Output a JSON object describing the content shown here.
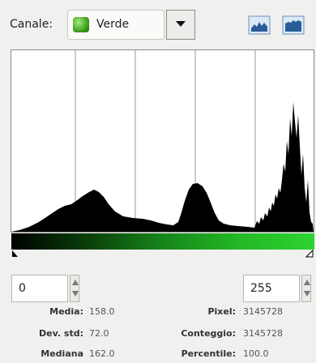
{
  "channel": {
    "label": "Canale:",
    "value": "Verde",
    "swatch_color": "#3fa21c"
  },
  "icons": {
    "dropdown": "chevron-down-icon",
    "linear": "linear-histogram-icon",
    "log": "log-histogram-icon"
  },
  "range": {
    "min": "0",
    "max": "255"
  },
  "stats": {
    "mean_label": "Media:",
    "mean_value": "158.0",
    "std_label": "Dev. std:",
    "std_value": "72.0",
    "median_label": "Mediana",
    "median_value": "162.0",
    "pixels_label": "Pixel:",
    "pixels_value": "3145728",
    "count_label": "Conteggio:",
    "count_value": "3145728",
    "percentile_label": "Percentile:",
    "percentile_value": "100.0"
  },
  "colors": {
    "accent": "#2ed332",
    "histogram_fill": "#000000"
  }
}
